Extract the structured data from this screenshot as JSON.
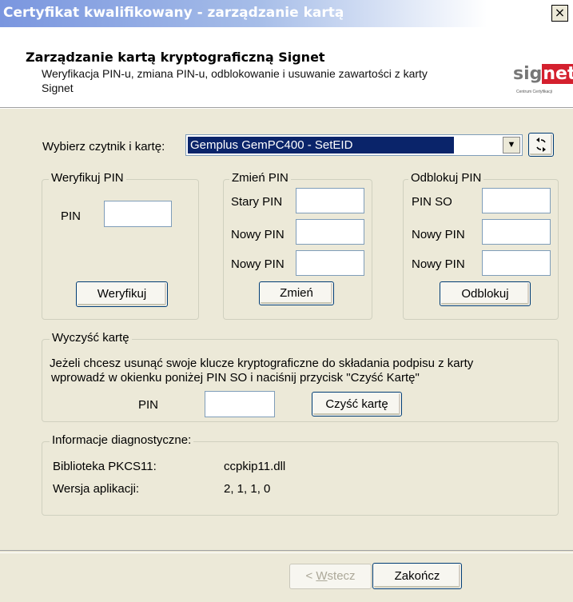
{
  "window": {
    "title": "Certyfikat kwalifikowany - zarządzanie kartą",
    "close_glyph": "×"
  },
  "header": {
    "title": "Zarządzanie kartą kryptograficzną Signet",
    "subtitle": "Weryfikacja PIN-u, zmiana PIN-u, odblokowanie i usuwanie zawartości z karty Signet",
    "logo_part1": "sig",
    "logo_part2": "net",
    "logo_tagline": "Centrum Certyfikacji",
    "brand_color": "#d4202e"
  },
  "reader": {
    "label": "Wybierz czytnik i kartę:",
    "selected": "Gemplus GemPC400 - SetEID",
    "dropdown_arrow": "▼",
    "refresh_icon": "refresh-icon"
  },
  "verify": {
    "legend": "Weryfikuj PIN",
    "pin_label": "PIN",
    "pin_value": "",
    "button": "Weryfikuj"
  },
  "change": {
    "legend": "Zmień PIN",
    "old_label": "Stary PIN",
    "new_label": "Nowy PIN",
    "new2_label": "Nowy PIN",
    "button": "Zmień"
  },
  "unblock": {
    "legend": "Odblokuj PIN",
    "so_label": "PIN SO",
    "new_label": "Nowy PIN",
    "new2_label": "Nowy PIN",
    "button": "Odblokuj"
  },
  "clear": {
    "legend": "Wyczyść kartę",
    "text_line1": "Jeżeli chcesz usunąć swoje klucze kryptograficzne do składania podpisu z karty",
    "text_line2": "wprowadź w okienku poniżej PIN SO i naciśnij przycisk \"Czyść Kartę\"",
    "pin_label": "PIN",
    "button": "Czyść kartę"
  },
  "diag": {
    "legend": "Informacje diagnostyczne:",
    "lib_label": "Biblioteka PKCS11:",
    "lib_value": "ccpkip11.dll",
    "ver_label": "Wersja aplikacji:",
    "ver_value": "2, 1, 1, 0"
  },
  "footer": {
    "back_prefix": "< ",
    "back_mnemonic": "W",
    "back_rest": "stecz",
    "finish": "Zakończ"
  }
}
